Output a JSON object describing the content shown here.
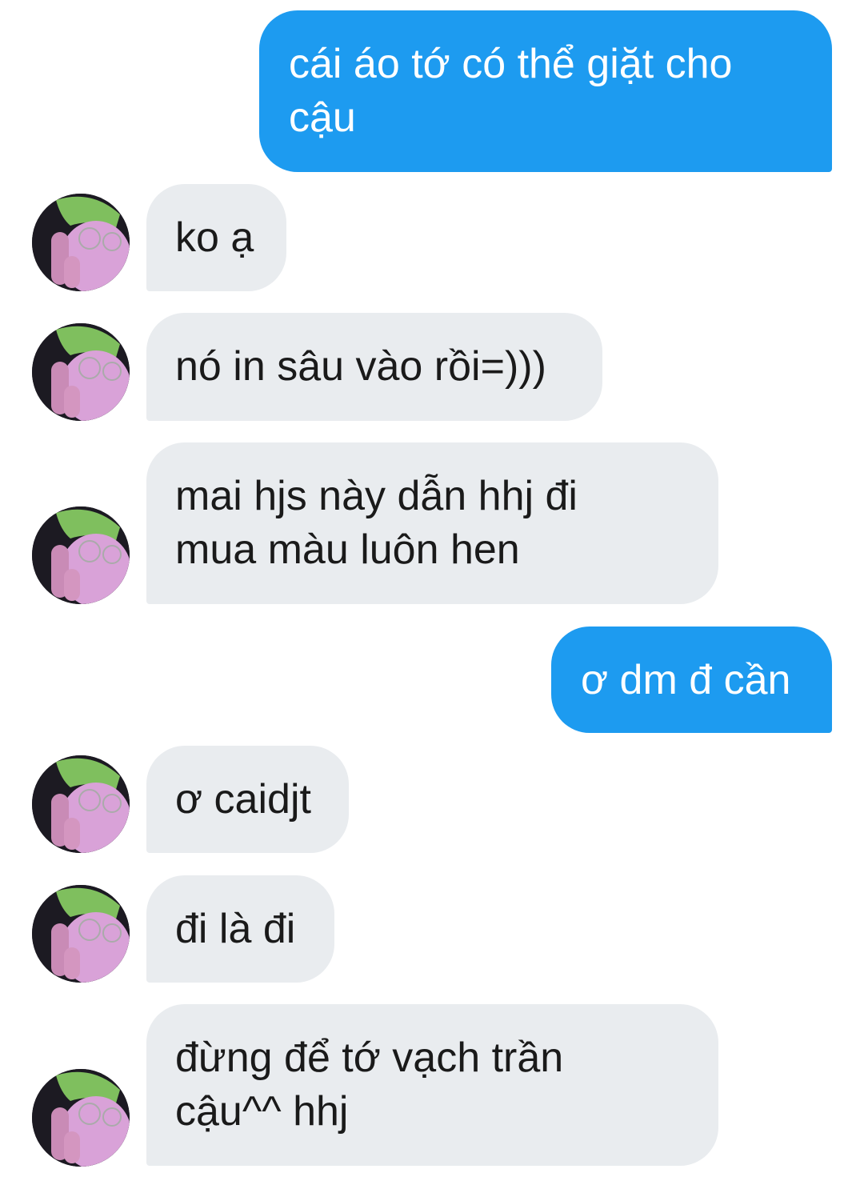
{
  "conversation": {
    "messages": [
      {
        "direction": "outgoing",
        "text": "cái áo tớ có thể giặt cho\ncậu"
      },
      {
        "direction": "incoming",
        "text": "ko ạ"
      },
      {
        "direction": "incoming",
        "text": "nó in sâu vào rồi=)))"
      },
      {
        "direction": "incoming",
        "text": "mai hjs này dẫn hhj đi\nmua màu luôn hen"
      },
      {
        "direction": "outgoing",
        "text": "ơ dm đ cần"
      },
      {
        "direction": "incoming",
        "text": "ơ caidjt"
      },
      {
        "direction": "incoming",
        "text": "đi là đi"
      },
      {
        "direction": "incoming",
        "text": "đừng để tớ vạch trần\ncậu^^ hhj"
      }
    ],
    "avatar_icon": "contact-avatar-photo"
  },
  "colors": {
    "outgoing_bubble": "#1d9bf0",
    "incoming_bubble": "#e9ecef",
    "background": "#ffffff"
  }
}
